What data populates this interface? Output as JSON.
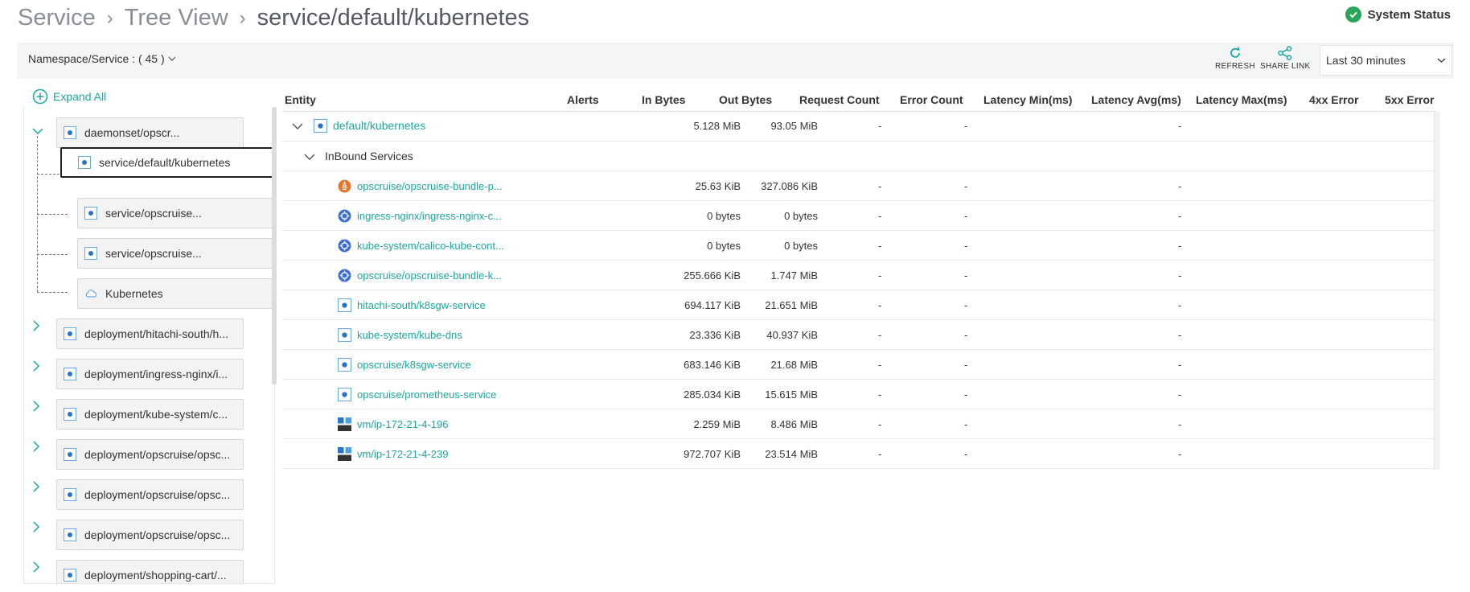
{
  "breadcrumb": {
    "item1": "Service",
    "item2": "Tree View",
    "current": "service/default/kubernetes",
    "separator": "›"
  },
  "system_status": {
    "label": "System Status",
    "color": "#2aa55b"
  },
  "toolbar": {
    "namespace_label": "Namespace/Service : ( 45 )",
    "refresh_label": "REFRESH",
    "share_label": "SHARE LINK",
    "time_range": "Last 30 minutes"
  },
  "tree": {
    "expand_all": "Expand All",
    "nodes": [
      {
        "label": "daemonset/opscr...",
        "kind": "workload"
      },
      {
        "label": "service/default/kubernetes",
        "kind": "service"
      },
      {
        "label": "service/opscruise...",
        "kind": "service"
      },
      {
        "label": "service/opscruise...",
        "kind": "service"
      },
      {
        "label": "Kubernetes",
        "kind": "cloud"
      },
      {
        "label": "deployment/hitachi-south/h...",
        "kind": "workload"
      },
      {
        "label": "deployment/ingress-nginx/i...",
        "kind": "workload"
      },
      {
        "label": "deployment/kube-system/c...",
        "kind": "workload"
      },
      {
        "label": "deployment/opscruise/opsc...",
        "kind": "workload"
      },
      {
        "label": "deployment/opscruise/opsc...",
        "kind": "workload"
      },
      {
        "label": "deployment/opscruise/opsc...",
        "kind": "workload"
      },
      {
        "label": "deployment/shopping-cart/...",
        "kind": "workload"
      }
    ]
  },
  "table": {
    "headers": [
      "Entity",
      "Alerts",
      "In Bytes",
      "Out Bytes",
      "Request Count",
      "Error Count",
      "Latency Min(ms)",
      "Latency Avg(ms)",
      "Latency Max(ms)",
      "4xx Error",
      "5xx Error"
    ],
    "root": {
      "entity": "default/kubernetes",
      "in": "5.128 MiB",
      "out": "93.05 MiB",
      "req": "-",
      "err": "-",
      "lat_avg": "-"
    },
    "group_label": "InBound Services",
    "rows": [
      {
        "entity": "opscruise/opscruise-bundle-p...",
        "icon": "prometheus",
        "in": "25.63 KiB",
        "out": "327.086 KiB",
        "req": "-",
        "err": "-",
        "lat_avg": "-"
      },
      {
        "entity": "ingress-nginx/ingress-nginx-c...",
        "icon": "k8s",
        "in": "0 bytes",
        "out": "0 bytes",
        "req": "-",
        "err": "-",
        "lat_avg": "-"
      },
      {
        "entity": "kube-system/calico-kube-cont...",
        "icon": "k8s",
        "in": "0 bytes",
        "out": "0 bytes",
        "req": "-",
        "err": "-",
        "lat_avg": "-"
      },
      {
        "entity": "opscruise/opscruise-bundle-k...",
        "icon": "k8s",
        "in": "255.666 KiB",
        "out": "1.747 MiB",
        "req": "-",
        "err": "-",
        "lat_avg": "-"
      },
      {
        "entity": "hitachi-south/k8sgw-service",
        "icon": "service",
        "in": "694.117 KiB",
        "out": "21.651 MiB",
        "req": "-",
        "err": "-",
        "lat_avg": "-"
      },
      {
        "entity": "kube-system/kube-dns",
        "icon": "service",
        "in": "23.336 KiB",
        "out": "40.937 KiB",
        "req": "-",
        "err": "-",
        "lat_avg": "-"
      },
      {
        "entity": "opscruise/k8sgw-service",
        "icon": "service",
        "in": "683.146 KiB",
        "out": "21.68 MiB",
        "req": "-",
        "err": "-",
        "lat_avg": "-"
      },
      {
        "entity": "opscruise/prometheus-service",
        "icon": "service",
        "in": "285.034 KiB",
        "out": "15.615 MiB",
        "req": "-",
        "err": "-",
        "lat_avg": "-"
      },
      {
        "entity": "vm/ip-172-21-4-196",
        "icon": "vm",
        "in": "2.259 MiB",
        "out": "8.486 MiB",
        "req": "-",
        "err": "-",
        "lat_avg": "-"
      },
      {
        "entity": "vm/ip-172-21-4-239",
        "icon": "vm",
        "in": "972.707 KiB",
        "out": "23.514 MiB",
        "req": "-",
        "err": "-",
        "lat_avg": "-"
      }
    ]
  },
  "colors": {
    "accent": "#19a8a0",
    "prometheus": "#e6772e",
    "k8s": "#3d6fd9",
    "vm": "#2a74c7"
  }
}
